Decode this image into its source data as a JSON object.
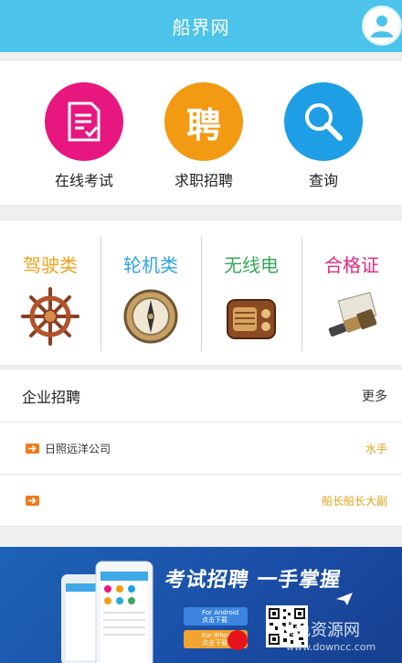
{
  "header": {
    "title": "船界网",
    "avatar_icon": "user-icon"
  },
  "quick_actions": [
    {
      "label": "在线考试",
      "icon": "exam-icon",
      "color": "#e7177f"
    },
    {
      "label": "求职招聘",
      "icon": "recruit-icon",
      "glyph": "聘",
      "color": "#f39a13"
    },
    {
      "label": "查询",
      "icon": "search-icon",
      "color": "#1e9fe5"
    }
  ],
  "categories": [
    {
      "name": "驾驶类",
      "color": "#f0a21b",
      "icon": "ship-wheel-icon"
    },
    {
      "name": "轮机类",
      "color": "#2ea6df",
      "icon": "compass-icon"
    },
    {
      "name": "无线电",
      "color": "#3aa95a",
      "icon": "radio-icon"
    },
    {
      "name": "合格证",
      "color": "#e1297c",
      "icon": "telescope-icon"
    }
  ],
  "jobs": {
    "title": "企业招聘",
    "more": "更多",
    "rows": [
      {
        "company": "日照远洋公司",
        "position": "水手"
      },
      {
        "company": "",
        "position": "船长船长大副"
      }
    ]
  },
  "banner": {
    "slogan": "考试招聘 一手掌握",
    "android_label": "For Android",
    "android_sub": "点击下载",
    "ios_label": "For iPhone",
    "ios_sub": "点击下载"
  },
  "watermark": {
    "text": "绿色资源网",
    "url": "www.downcc.com"
  }
}
